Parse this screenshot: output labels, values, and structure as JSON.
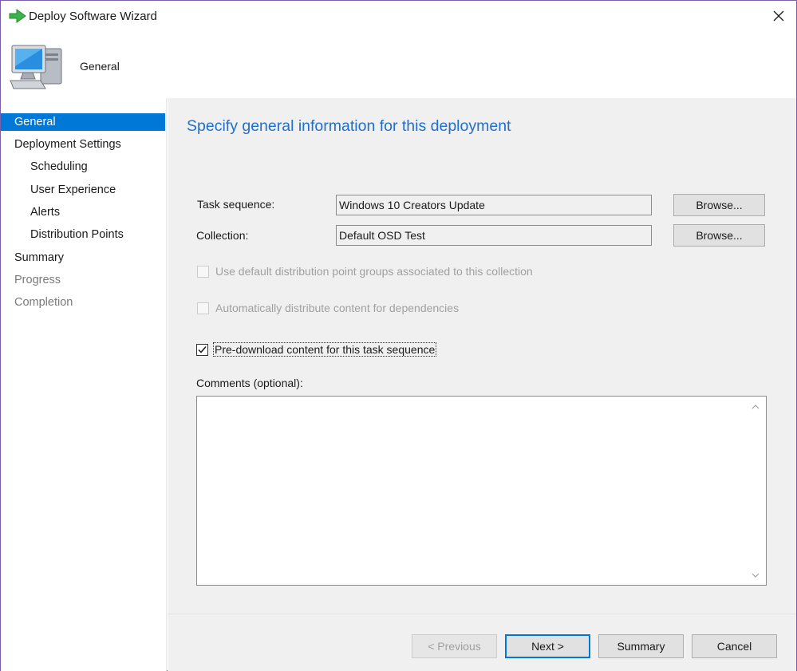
{
  "window": {
    "title": "Deploy Software Wizard",
    "header_title": "General"
  },
  "sidebar": {
    "items": [
      {
        "label": "General",
        "state": "active"
      },
      {
        "label": "Deployment Settings",
        "state": "normal"
      },
      {
        "label": "Scheduling",
        "state": "normal"
      },
      {
        "label": "User Experience",
        "state": "normal"
      },
      {
        "label": "Alerts",
        "state": "normal"
      },
      {
        "label": "Distribution Points",
        "state": "normal"
      },
      {
        "label": "Summary",
        "state": "normal"
      },
      {
        "label": "Progress",
        "state": "disabled"
      },
      {
        "label": "Completion",
        "state": "disabled"
      }
    ]
  },
  "main": {
    "title": "Specify general information for this deployment",
    "task_sequence": {
      "label": "Task sequence:",
      "value": "Windows 10 Creators Update",
      "browse": "Browse..."
    },
    "collection": {
      "label": "Collection:",
      "value": "Default OSD Test",
      "browse": "Browse..."
    },
    "checkboxes": [
      {
        "label": "Use default distribution point groups associated to this collection",
        "checked": false,
        "enabled": false
      },
      {
        "label": "Automatically distribute content for dependencies",
        "checked": false,
        "enabled": false
      },
      {
        "label": "Pre-download content for this task sequence",
        "checked": true,
        "enabled": true
      }
    ],
    "comments": {
      "label": "Comments (optional):",
      "value": ""
    }
  },
  "footer": {
    "previous": "< Previous",
    "next": "Next >",
    "summary": "Summary",
    "cancel": "Cancel"
  },
  "colors": {
    "accent": "#0078d7",
    "title_blue": "#1f6fce",
    "panel_bg": "#f0f0f0"
  }
}
